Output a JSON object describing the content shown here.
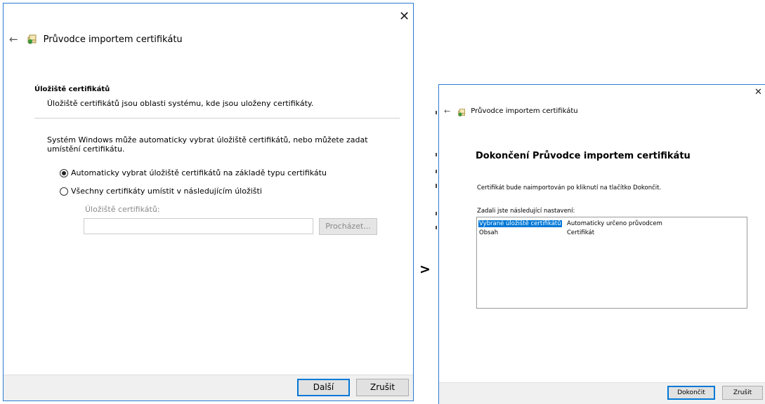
{
  "left": {
    "title": "Průvodce importem certifikátu",
    "section_title": "Úložiště certifikátů",
    "section_subtitle": "Úložiště certifikátů jsou oblasti systému, kde jsou uloženy certifikáty.",
    "description": "Systém Windows může automaticky vybrat úložiště certifikátů, nebo můžete zadat umístění certifikátu.",
    "option_auto": "Automaticky vybrat úložiště certifikátů na základě typu certifikátu",
    "option_manual": "Všechny certifikáty umístit v následujícím úložišti",
    "store_label": "Úložiště certifikátů:",
    "store_value": "",
    "browse_label": "Procházet...",
    "next_label": "Další",
    "cancel_label": "Zrušit"
  },
  "arrow": ">",
  "right": {
    "title": "Průvodce importem certifikátu",
    "heading": "Dokončení Průvodce importem certifikátu",
    "info": "Certifikát bude naimportován po kliknutí na tlačítko Dokončit.",
    "settings_label": "Zadali jste následující nastavení:",
    "settings": [
      {
        "name": "Vybrané úložiště certifikátů",
        "value": "Automaticky určeno průvodcem"
      },
      {
        "name": "Obsah",
        "value": "Certifikát"
      }
    ],
    "finish_label": "Dokončit",
    "cancel_label": "Zrušit"
  }
}
